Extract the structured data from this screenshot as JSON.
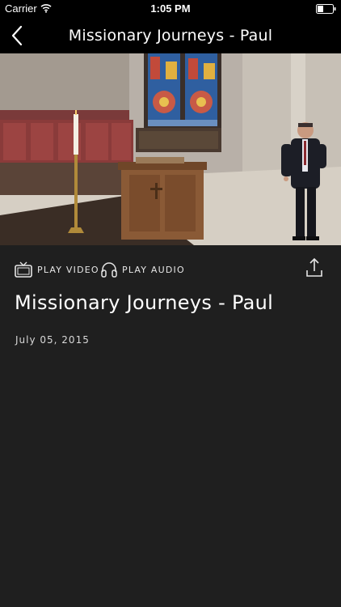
{
  "status_bar": {
    "carrier": "Carrier",
    "time": "1:05 PM",
    "icons": [
      "wifi-icon",
      "battery-icon"
    ]
  },
  "nav": {
    "title": "Missionary Journeys - Paul",
    "back_icon": "chevron-left-icon"
  },
  "video": {
    "description": "sermon video thumbnail"
  },
  "actions": {
    "play_video_label": "PLAY VIDEO",
    "play_video_icon": "tv-icon",
    "play_audio_label": "PLAY AUDIO",
    "play_audio_icon": "headphones-icon",
    "share_icon": "share-icon"
  },
  "sermon": {
    "title": "Missionary Journeys - Paul",
    "date": "July 05, 2015"
  },
  "colors": {
    "background": "#1f1f1f",
    "bars": "#000000",
    "text": "#ffffff"
  }
}
